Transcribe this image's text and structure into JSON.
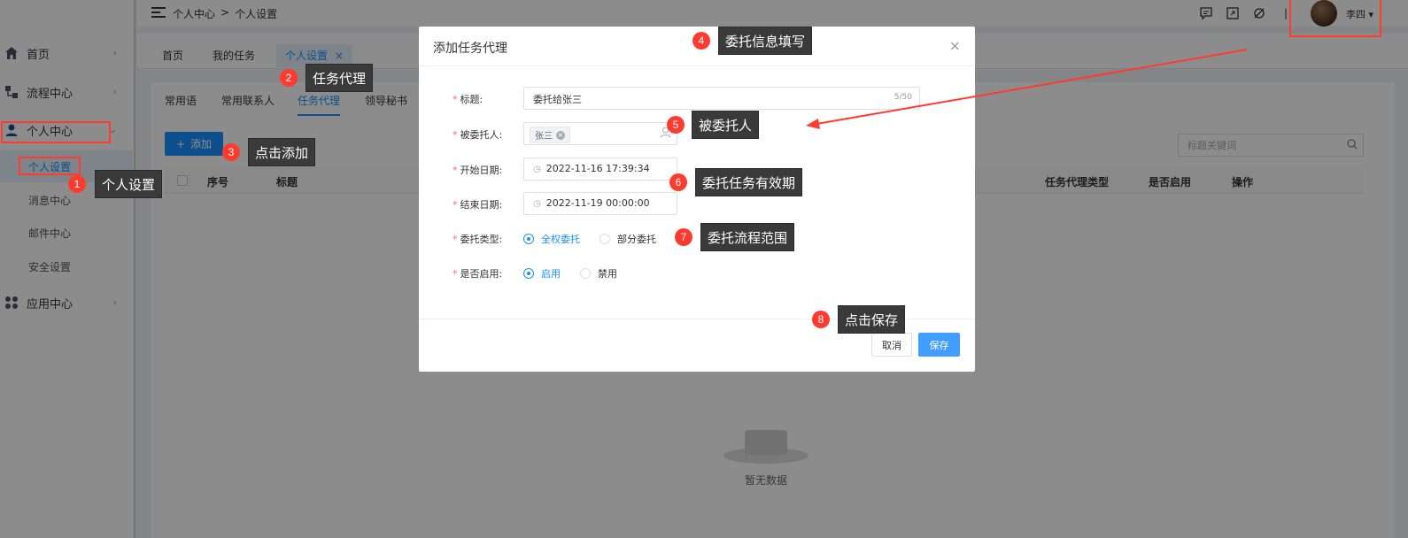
{
  "sidebar": {
    "items": [
      {
        "label": "首页",
        "icon": "home-icon"
      },
      {
        "label": "流程中心",
        "icon": "flow-icon"
      },
      {
        "label": "个人中心",
        "icon": "user-icon"
      },
      {
        "label": "应用中心",
        "icon": "apps-icon"
      }
    ],
    "submenu": [
      "个人设置",
      "消息中心",
      "邮件中心",
      "安全设置"
    ]
  },
  "topbar": {
    "breadcrumb": [
      "个人中心",
      ">",
      "个人设置"
    ],
    "username": "李四"
  },
  "tabs": [
    "首页",
    "我的任务",
    "个人设置"
  ],
  "tab_close": "×",
  "subtabs": [
    "常用语",
    "常用联系人",
    "任务代理",
    "领导秘书"
  ],
  "toolbar": {
    "add_label": "添加",
    "add_plus": "+",
    "search_placeholder": "标题关键词"
  },
  "table": {
    "headers": [
      "序号",
      "标题",
      "任务代理类型",
      "是否启用",
      "操作"
    ],
    "empty_text": "暂无数据"
  },
  "dialog": {
    "title": "添加任务代理",
    "close": "×",
    "fields": {
      "title_label": "标题:",
      "title_value": "委托给张三",
      "title_counter": "5/50",
      "delegate_label": "被委托人:",
      "delegate_tag": "张三",
      "start_label": "开始日期:",
      "start_value": "2022-11-16 17:39:34",
      "end_label": "结束日期:",
      "end_value": "2022-11-19 00:00:00",
      "type_label": "委托类型:",
      "type_options": [
        "全权委托",
        "部分委托"
      ],
      "type_selected": "全权委托",
      "enable_label": "是否启用:",
      "enable_options": [
        "启用",
        "禁用"
      ],
      "enable_selected": "启用"
    },
    "cancel_label": "取消",
    "save_label": "保存"
  },
  "annotations": [
    {
      "num": "1",
      "text": "个人设置"
    },
    {
      "num": "2",
      "text": "任务代理"
    },
    {
      "num": "3",
      "text": "点击添加"
    },
    {
      "num": "4",
      "text": "委托信息填写"
    },
    {
      "num": "5",
      "text": "被委托人"
    },
    {
      "num": "6",
      "text": "委托任务有效期"
    },
    {
      "num": "7",
      "text": "委托流程范围"
    },
    {
      "num": "8",
      "text": "点击保存"
    }
  ],
  "colors": {
    "accent": "#1890ff",
    "annotation_red": "#ff3b30",
    "callout_bg": "#3a3a3a"
  }
}
